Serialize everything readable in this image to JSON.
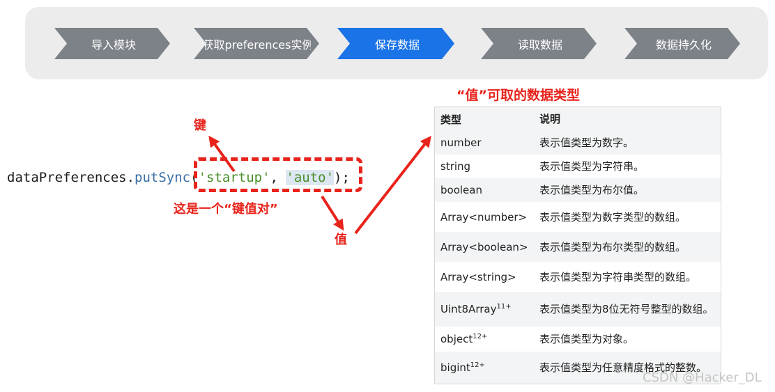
{
  "steps": [
    {
      "label": "导入模块",
      "active": false
    },
    {
      "label": "获取preferences实例",
      "active": false
    },
    {
      "label": "保存数据",
      "active": true
    },
    {
      "label": "读取数据",
      "active": false
    },
    {
      "label": "数据持久化",
      "active": false
    }
  ],
  "colors": {
    "step_inactive": "#7d8288",
    "step_active": "#1a74e8",
    "annotation": "#e8231b"
  },
  "code": {
    "prefix": "dataPreferences.",
    "method": "putSync",
    "open": "(",
    "key_str": "'startup'",
    "sep": ", ",
    "value_str": "'auto'",
    "close": ");"
  },
  "annotations": {
    "key_label": "键",
    "pair_label": "这是一个“键值对”",
    "value_label": "值"
  },
  "table": {
    "title": "“值”可取的数据类型",
    "headers": {
      "type": "类型",
      "desc": "说明"
    },
    "rows": [
      {
        "type": "number",
        "sup": "",
        "desc": "表示值类型为数字。"
      },
      {
        "type": "string",
        "sup": "",
        "desc": "表示值类型为字符串。"
      },
      {
        "type": "boolean",
        "sup": "",
        "desc": "表示值类型为布尔值。"
      },
      {
        "type": "Array<number>",
        "sup": "",
        "desc": "表示值类型为数字类型的数组。"
      },
      {
        "type": "Array<boolean>",
        "sup": "",
        "desc": "表示值类型为布尔类型的数组。"
      },
      {
        "type": "Array<string>",
        "sup": "",
        "desc": "表示值类型为字符串类型的数组。"
      },
      {
        "type": "Uint8Array",
        "sup": "11+",
        "desc": "表示值类型为8位无符号整型的数组。"
      },
      {
        "type": "object",
        "sup": "12+",
        "desc": "表示值类型为对象。"
      },
      {
        "type": "bigint",
        "sup": "12+",
        "desc": "表示值类型为任意精度格式的整数。"
      }
    ]
  },
  "watermark": "CSDN @Hacker_DL"
}
